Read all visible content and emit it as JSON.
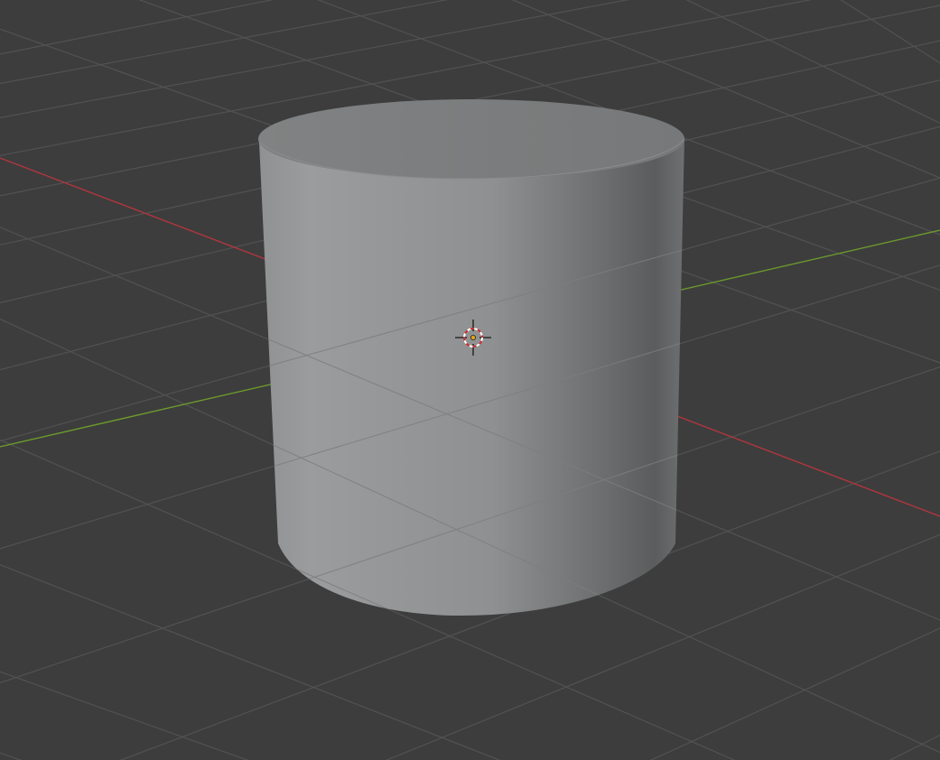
{
  "viewport": {
    "background_color": "#3d3d3d",
    "grid_line_color": "#545454",
    "axis_x_color": "#b0363f",
    "axis_y_color": "#6c9a2c"
  },
  "object": {
    "type": "cylinder",
    "shading": "solid",
    "base_color": "#9a9c9d"
  },
  "origin_marker": {
    "icon": "origin-dot-icon",
    "color": "#e8a317"
  },
  "cursor_3d": {
    "icon": "3d-cursor-icon",
    "ring_colors": [
      "#ffffff",
      "#d12a2a"
    ]
  }
}
